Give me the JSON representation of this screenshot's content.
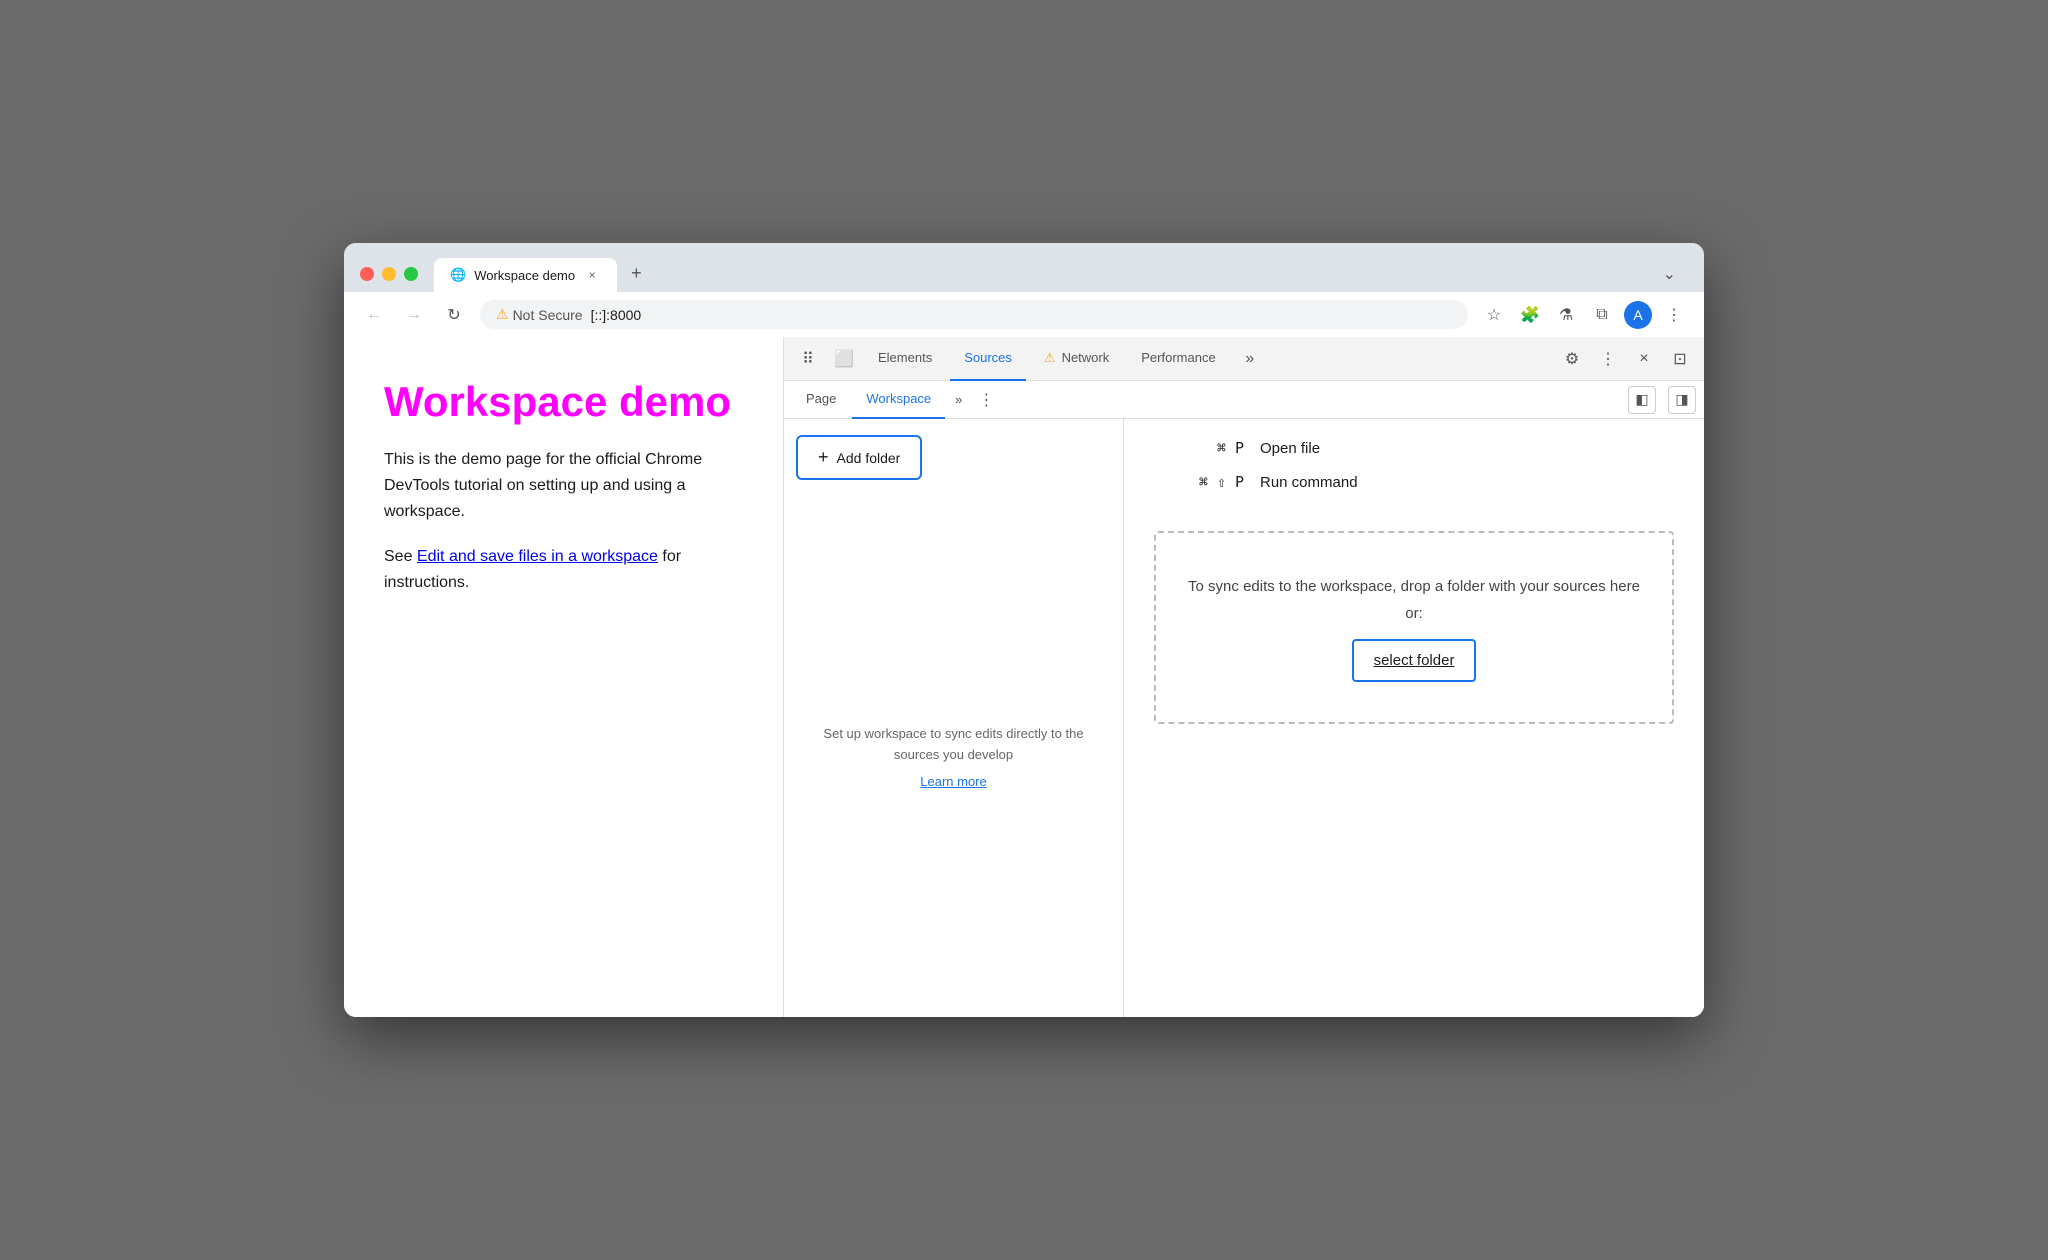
{
  "browser": {
    "tab": {
      "favicon": "🌐",
      "title": "Workspace demo",
      "close_label": "×"
    },
    "new_tab_label": "+",
    "overflow_label": "⌄",
    "nav": {
      "back_label": "←",
      "forward_label": "→",
      "reload_label": "↻"
    },
    "address": {
      "security_label": "Not Secure",
      "url": "[::]:8000"
    },
    "toolbar": {
      "bookmark_label": "☆",
      "extension_label": "🧩",
      "labs_label": "⚗",
      "split_label": "⧉",
      "profile_label": "A",
      "menu_label": "⋮"
    }
  },
  "webpage": {
    "title": "Workspace demo",
    "description": "This is the demo page for the official Chrome DevTools tutorial on setting up and using a workspace.",
    "see_label": "See",
    "link_text": "Edit and save files in a workspace",
    "instructions_label": "for instructions."
  },
  "devtools": {
    "topbar": {
      "inspect_label": "⠿",
      "device_label": "⬜",
      "tabs": [
        {
          "id": "elements",
          "label": "Elements",
          "active": false,
          "warning": false
        },
        {
          "id": "sources",
          "label": "Sources",
          "active": true,
          "warning": false
        },
        {
          "id": "network",
          "label": "Network",
          "active": false,
          "warning": true
        },
        {
          "id": "performance",
          "label": "Performance",
          "active": false,
          "warning": false
        }
      ],
      "overflow_label": "»",
      "settings_label": "⚙",
      "more_label": "⋮",
      "close_label": "×",
      "panel_right_label": "⊡"
    },
    "sources": {
      "subtabs": [
        {
          "id": "page",
          "label": "Page",
          "active": false
        },
        {
          "id": "workspace",
          "label": "Workspace",
          "active": true
        }
      ],
      "subtab_overflow_label": "»",
      "subtab_more_label": "⋮",
      "panel_btn_label": "◧",
      "panel_right_btn_label": "◨",
      "add_folder_label": "Add folder",
      "empty_message": "Set up workspace to sync edits directly to the sources you develop",
      "learn_more_label": "Learn more",
      "shortcut_open_file_keys": "⌘ P",
      "shortcut_open_file_label": "Open file",
      "shortcut_run_cmd_keys": "⌘ ⇧ P",
      "shortcut_run_cmd_label": "Run command",
      "drop_zone_text": "To sync edits to the workspace, drop a folder with your sources here or:",
      "select_folder_label": "select folder"
    }
  }
}
